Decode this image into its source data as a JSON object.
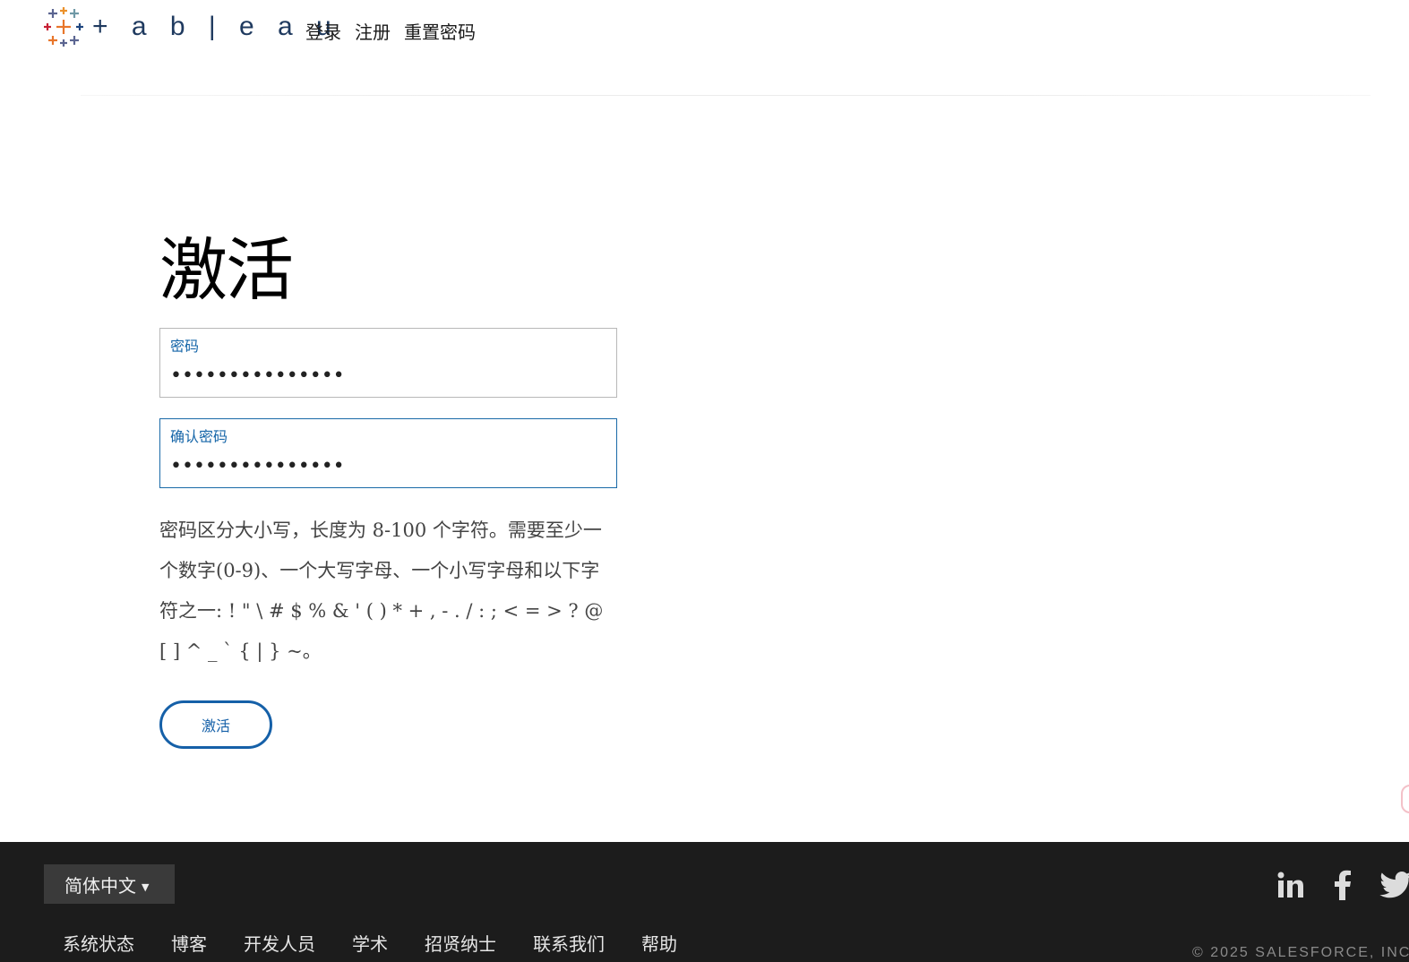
{
  "header": {
    "logo_text": "+ a b | e a u",
    "nav": [
      "登录",
      "注册",
      "重置密码"
    ]
  },
  "main": {
    "title": "激活",
    "password_field": {
      "label": "密码",
      "value": "•••••••••••••••"
    },
    "confirm_field": {
      "label": "确认密码",
      "value": "•••••••••••••••"
    },
    "hint": "密码区分大小写，长度为 8-100 个字符。需要至少一个数字(0-9)、一个大写字母、一个小写字母和以下字符之一: ! \" \\ # $ % & ' ( ) * + , - . / : ; < = > ? @ [ ] ^ _ ` { | } ~。",
    "activate_button": "激活"
  },
  "footer": {
    "language": "简体中文",
    "links": [
      "系统状态",
      "博客",
      "开发人员",
      "学术",
      "招贤纳士",
      "联系我们",
      "帮助"
    ],
    "social": [
      "linkedin-icon",
      "facebook-icon",
      "twitter-icon"
    ],
    "copyright": "© 2025 SALESFORCE, INC."
  },
  "colors": {
    "accent": "#1560a8",
    "footer_bg": "#1c1c1c",
    "lang_bg": "#3a3a3a"
  }
}
